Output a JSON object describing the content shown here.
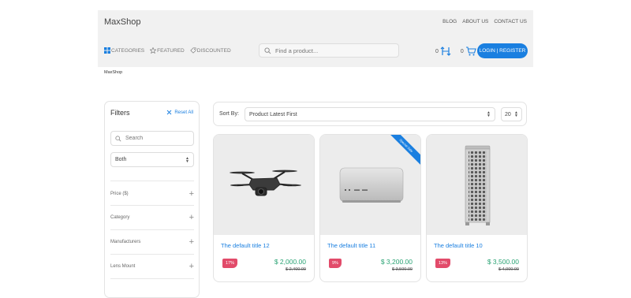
{
  "header": {
    "logo": "MaxShop",
    "links": [
      "BLOG",
      "ABOUT US",
      "CONTACT US"
    ],
    "nav": [
      {
        "label": "CATEGORIES",
        "icon": "grid-icon"
      },
      {
        "label": "FEATURED",
        "icon": "star-icon"
      },
      {
        "label": "DISCOUNTED",
        "icon": "tag-icon"
      }
    ],
    "search_placeholder": "Find a product...",
    "compare_count": "0",
    "cart_count": "0",
    "login_label": "LOGIN | REGISTER"
  },
  "breadcrumb": "MaxShop",
  "filters": {
    "title": "Filters",
    "reset_label": "Reset All",
    "search_placeholder": "Search",
    "select_value": "Both",
    "sections": [
      "Price ($)",
      "Category",
      "Manufacturers",
      "Lens Mount"
    ]
  },
  "sort": {
    "label": "Sort By:",
    "value": "Product Latest First",
    "per_page": "20"
  },
  "products": [
    {
      "title": "The default title 12",
      "discount": "17%",
      "price": "$ 2,000.00",
      "old_price": "$ 2,400.00",
      "image": "drone",
      "ribbon": ""
    },
    {
      "title": "The default title 11",
      "discount": "9%",
      "price": "$ 3,200.00",
      "old_price": "$ 3,500.00",
      "image": "mac-studio",
      "ribbon": "Special Sale"
    },
    {
      "title": "The default title 10",
      "discount": "13%",
      "price": "$ 3,500.00",
      "old_price": "$ 4,000.00",
      "image": "mac-pro",
      "ribbon": ""
    }
  ],
  "colors": {
    "accent": "#1a7fe0",
    "price": "#2aa374",
    "discount": "#e24b6a"
  }
}
